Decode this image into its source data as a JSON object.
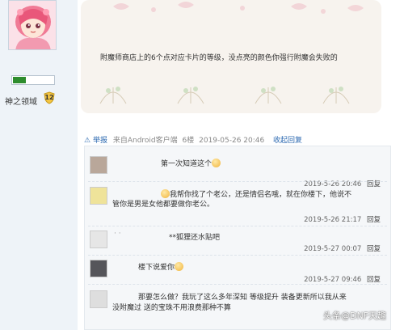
{
  "post": {
    "content": "附魔师商店上的6个点对应卡片的等级，没点亮的颜色你强行附魔会失败的",
    "meta": {
      "reply_label": "举报",
      "source": "来自Android客户端",
      "floor": "6楼",
      "timestamp": "2019-05-26 20:46",
      "collapse_label": "收起回复"
    }
  },
  "user": {
    "title": "神之领域",
    "level": "12",
    "level_progress": 0.3
  },
  "replies": [
    {
      "text": "第一次知道这个",
      "timestamp": "2019-5-26 20:46",
      "reply_label": "回复"
    },
    {
      "text_line1": "我帮你找了个老公，还是情侣名哦，就在你楼下，他说不",
      "text_line2": "管你是男是女他都要做你老公。",
      "timestamp": "2019-5-26 21:17",
      "reply_label": "回复"
    },
    {
      "prefix": "· ·",
      "text": "**狐狸还水贴吧",
      "timestamp": "2019-5-27 00:07",
      "reply_label": "回复"
    },
    {
      "text": "楼下说爱你",
      "timestamp": "2019-5-27 09:46",
      "reply_label": "回复"
    },
    {
      "text_line1": "那要怎么做？我玩了这么多年深知 等级提升 装备更新所以我从来",
      "text_line2": "没附魔过 送的宝珠不用浪费那种不算"
    }
  ],
  "watermark": "头条@DNF天趣",
  "colors": {
    "link": "#2d6ab1",
    "level_fill": "#2d8c2d",
    "card_bg": "#f7f3ee",
    "sidebar_bg": "#eef3f8"
  }
}
